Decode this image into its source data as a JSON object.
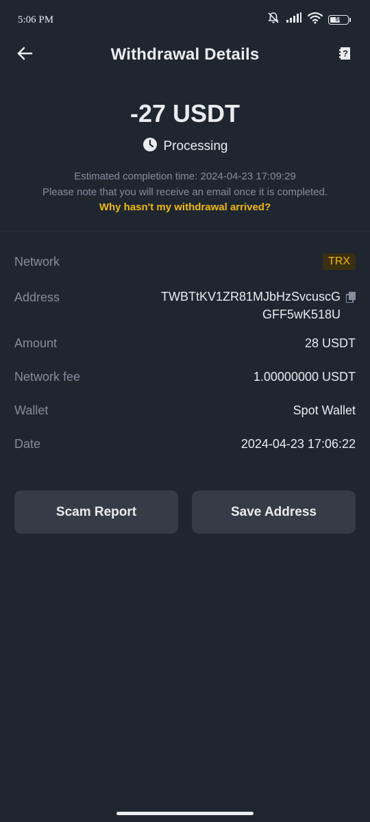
{
  "status_bar": {
    "time": "5:06 PM",
    "battery": "59",
    "battery_level": 0.59,
    "icons": [
      "bell-muted-icon",
      "signal-icon",
      "wifi-icon",
      "battery-icon"
    ]
  },
  "header": {
    "title": "Withdrawal Details",
    "back_icon": "arrow-left-icon",
    "help_icon": "help-document-icon"
  },
  "summary": {
    "amount": "-27 USDT",
    "status": "Processing",
    "status_icon": "clock-icon",
    "note_line1": "Estimated completion time: 2024-04-23 17:09:29",
    "note_line2": "Please note that you will receive an email once it is completed.",
    "link": "Why hasn't my withdrawal arrived?"
  },
  "details": {
    "network": {
      "label": "Network",
      "value": "TRX"
    },
    "address": {
      "label": "Address",
      "value_line1": "TWBTtKV1ZR81MJbHzSvcuscG",
      "value_line2": "GFF5wK518U"
    },
    "amount": {
      "label": "Amount",
      "value": "28 USDT"
    },
    "network_fee": {
      "label": "Network fee",
      "value": "1.00000000 USDT"
    },
    "wallet": {
      "label": "Wallet",
      "value": "Spot Wallet"
    },
    "date": {
      "label": "Date",
      "value": "2024-04-23 17:06:22"
    }
  },
  "buttons": {
    "scam_report": "Scam Report",
    "save_address": "Save Address"
  },
  "colors": {
    "background": "#1f2630",
    "accent": "#f0b90b",
    "secondary_text": "#848e9c",
    "button_bg": "#363c47"
  }
}
